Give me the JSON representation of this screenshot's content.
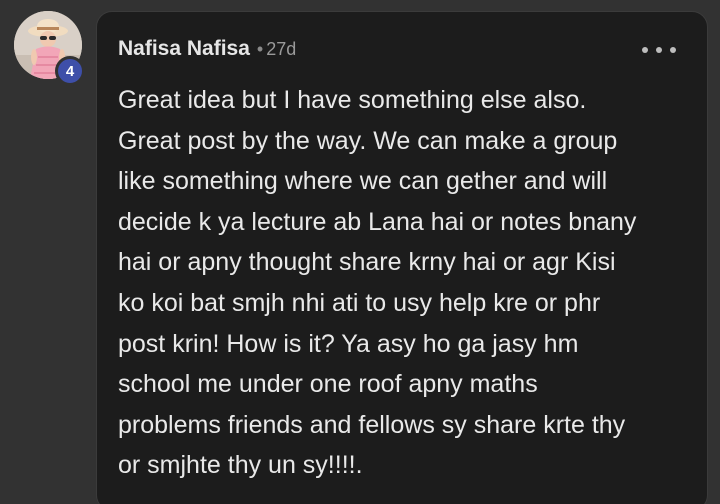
{
  "comment": {
    "author": "Nafisa Nafisa",
    "separator": "•",
    "time": "27d",
    "badge_count": "4",
    "more_icon": "ellipsis-horizontal-icon",
    "avatar_icon": "avatar-photo-icon",
    "lines": [
      "Great idea but I have something else also.",
      "Great post by the way. We can make a group",
      "like something where we can gether and will",
      "decide k ya lecture ab Lana hai or notes bnany",
      "hai or apny thought share krny hai or agr Kisi",
      "ko koi bat smjh nhi ati to usy help kre or phr",
      "post krin! How is it? Ya asy ho ga jasy hm",
      "school me under one roof apny maths",
      "problems friends and fellows sy share krte thy",
      "or smjhte thy un sy!!!!."
    ]
  },
  "colors": {
    "page_background": "#323232",
    "card_background": "#1c1c1c",
    "badge_background": "#3e4fa9",
    "text": "#e9e9e9",
    "muted": "#9a9a9a"
  }
}
